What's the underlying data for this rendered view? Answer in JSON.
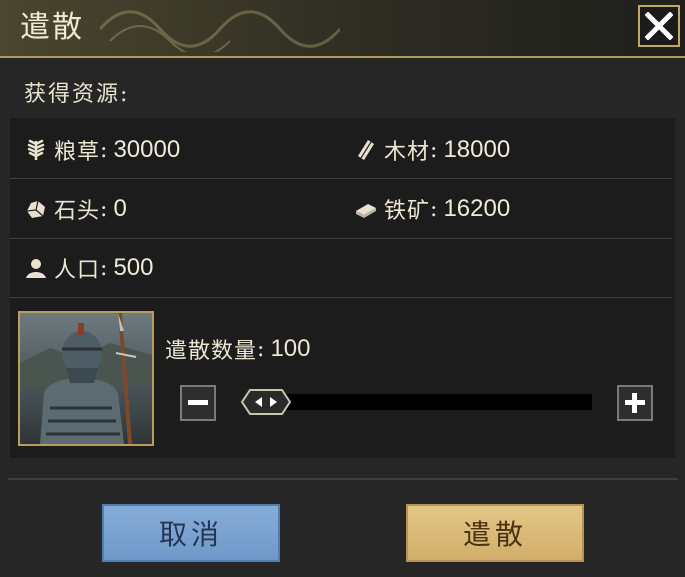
{
  "dialog": {
    "title": "遣散",
    "close_icon": "close-icon"
  },
  "resources": {
    "label": "获得资源:",
    "items": [
      {
        "name": "粮草",
        "value": "30000",
        "icon": "grain-icon"
      },
      {
        "name": "木材",
        "value": "18000",
        "icon": "wood-icon"
      },
      {
        "name": "石头",
        "value": "0",
        "icon": "stone-icon"
      },
      {
        "name": "铁矿",
        "value": "16200",
        "icon": "iron-ore-icon"
      },
      {
        "name": "人口",
        "value": "500",
        "icon": "population-icon"
      }
    ]
  },
  "dismiss": {
    "quantity_label": "遣散数量",
    "quantity_value": "100",
    "slider_fraction": 0.0,
    "minus_icon": "minus-icon",
    "plus_icon": "plus-icon",
    "slider_handle_icon": "slider-handle-icon"
  },
  "buttons": {
    "cancel_label": "取消",
    "confirm_label": "遣散"
  },
  "colors": {
    "gold_border": "#c2a867",
    "cancel_button": "#7aa2d2",
    "confirm_button": "#dcbc79"
  }
}
